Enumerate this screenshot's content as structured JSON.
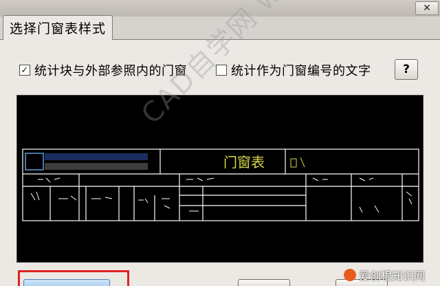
{
  "dialog": {
    "tab_label": "选择门窗表样式",
    "close_glyph": "✕"
  },
  "options": {
    "count_blocks": {
      "label": "统计块与外部参照内的门窗",
      "checked": true
    },
    "count_text": {
      "label": "统计作为门窗编号的文字",
      "checked": false
    },
    "help_label": "?"
  },
  "preview": {
    "cad_title": "门窗表",
    "watermark": "CAD自学网 www.cadzxw.com",
    "bg_color": "#000000",
    "line_color": "#ffffff",
    "accent_color": "#d9d94a"
  },
  "watermark_corner": "爱创根知识网"
}
